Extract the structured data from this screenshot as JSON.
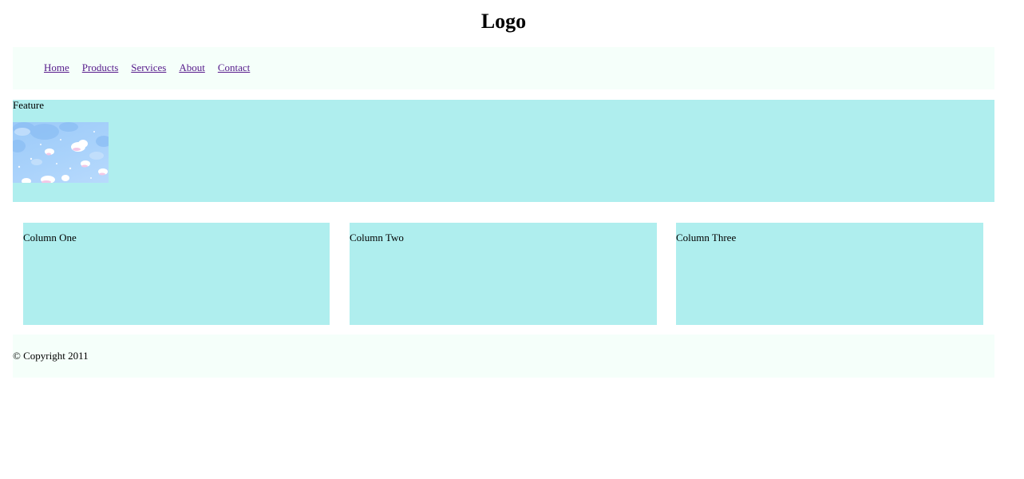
{
  "header": {
    "logo": "Logo"
  },
  "nav": {
    "items": [
      {
        "label": "Home"
      },
      {
        "label": "Products"
      },
      {
        "label": "Services"
      },
      {
        "label": "About"
      },
      {
        "label": "Contact"
      }
    ]
  },
  "feature": {
    "label": "Feature",
    "image_icon": "clouds-image"
  },
  "columns": [
    {
      "label": "Column One"
    },
    {
      "label": "Column Two"
    },
    {
      "label": "Column Three"
    }
  ],
  "footer": {
    "copyright": "© Copyright 2011"
  },
  "colors": {
    "panel_background": "#afeeee",
    "nav_background": "#f5fffa",
    "link_color": "#551a8b"
  }
}
